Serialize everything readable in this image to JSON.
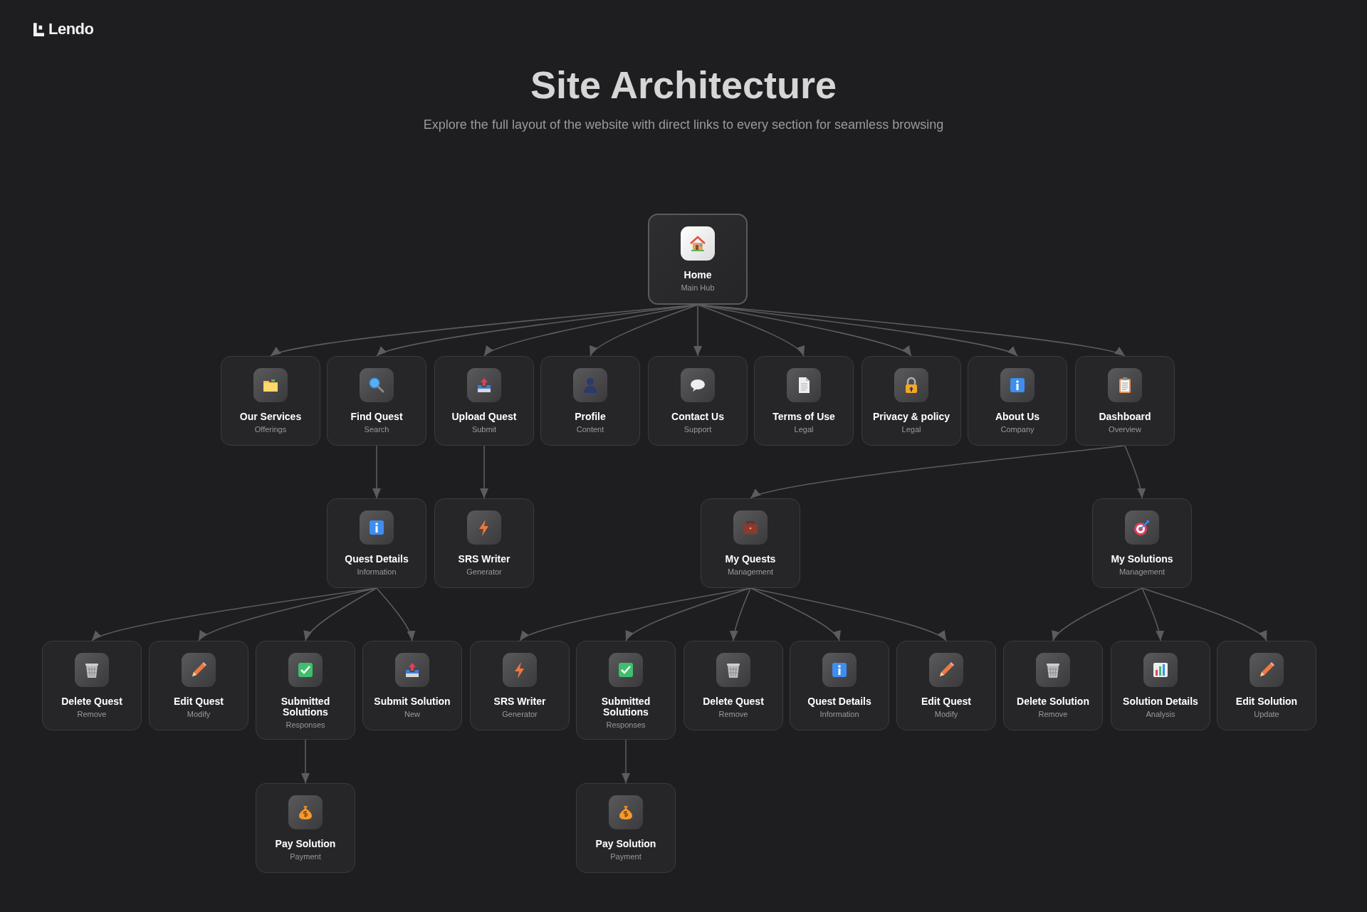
{
  "logo": {
    "text": "Lendo"
  },
  "title": "Site Architecture",
  "subtitle": "Explore the full layout of the website with direct links to every section for seamless browsing",
  "tree": {
    "title": "Home",
    "subtitle": "Main Hub",
    "kind": "home",
    "children": [
      {
        "title": "Our Services",
        "subtitle": "Offerings",
        "kind": "folder"
      },
      {
        "title": "Find Quest",
        "subtitle": "Search",
        "kind": "search",
        "children": [
          {
            "title": "Quest Details",
            "subtitle": "Information",
            "kind": "info",
            "children": [
              {
                "title": "Delete Quest",
                "subtitle": "Remove",
                "kind": "trash"
              },
              {
                "title": "Edit Quest",
                "subtitle": "Modify",
                "kind": "pencil"
              },
              {
                "title": "Submitted Solutions",
                "subtitle": "Responses",
                "kind": "check",
                "children": [
                  {
                    "title": "Pay Solution",
                    "subtitle": "Payment",
                    "kind": "money"
                  }
                ]
              },
              {
                "title": "Submit Solution",
                "subtitle": "New",
                "kind": "upload"
              }
            ]
          }
        ]
      },
      {
        "title": "Upload Quest",
        "subtitle": "Submit",
        "kind": "upload",
        "children": [
          {
            "title": "SRS Writer",
            "subtitle": "Generator",
            "kind": "bolt"
          }
        ]
      },
      {
        "title": "Profile",
        "subtitle": "Content",
        "kind": "person"
      },
      {
        "title": "Contact Us",
        "subtitle": "Support",
        "kind": "chat"
      },
      {
        "title": "Terms of Use",
        "subtitle": "Legal",
        "kind": "document"
      },
      {
        "title": "Privacy & policy",
        "subtitle": "Legal",
        "kind": "lock"
      },
      {
        "title": "About Us",
        "subtitle": "Company",
        "kind": "info"
      },
      {
        "title": "Dashboard",
        "subtitle": "Overview",
        "kind": "clipboard",
        "children": [
          {
            "title": "My Quests",
            "subtitle": "Management",
            "kind": "briefcase",
            "children": [
              {
                "title": "SRS Writer",
                "subtitle": "Generator",
                "kind": "bolt"
              },
              {
                "title": "Submitted Solutions",
                "subtitle": "Responses",
                "kind": "check",
                "children": [
                  {
                    "title": "Pay Solution",
                    "subtitle": "Payment",
                    "kind": "money"
                  }
                ]
              },
              {
                "title": "Delete Quest",
                "subtitle": "Remove",
                "kind": "trash"
              },
              {
                "title": "Quest Details",
                "subtitle": "Information",
                "kind": "info"
              },
              {
                "title": "Edit Quest",
                "subtitle": "Modify",
                "kind": "pencil"
              }
            ]
          },
          {
            "title": "My Solutions",
            "subtitle": "Management",
            "kind": "target",
            "children": [
              {
                "title": "Delete Solution",
                "subtitle": "Remove",
                "kind": "trash"
              },
              {
                "title": "Solution Details",
                "subtitle": "Analysis",
                "kind": "chart"
              },
              {
                "title": "Edit Solution",
                "subtitle": "Update",
                "kind": "pencil"
              }
            ]
          }
        ]
      }
    ]
  }
}
